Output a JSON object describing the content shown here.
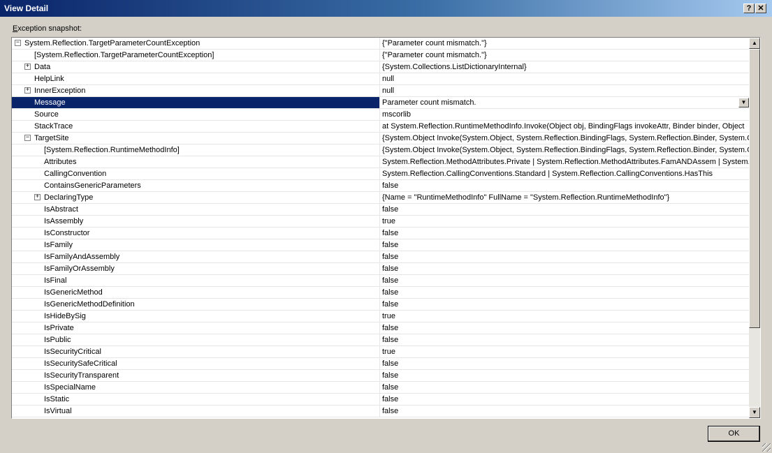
{
  "window": {
    "title": "View Detail",
    "help_label": "?",
    "close_label": "✕"
  },
  "snapshot_label": {
    "accel": "E",
    "rest": "xception snapshot:"
  },
  "rows": [
    {
      "name": "System.Reflection.TargetParameterCountException",
      "value": "{\"Parameter count mismatch.\"}",
      "level": 0,
      "expander": "minus"
    },
    {
      "name": "[System.Reflection.TargetParameterCountException]",
      "value": "{\"Parameter count mismatch.\"}",
      "level": 1,
      "expander": ""
    },
    {
      "name": "Data",
      "value": "{System.Collections.ListDictionaryInternal}",
      "level": 1,
      "expander": "plus"
    },
    {
      "name": "HelpLink",
      "value": "null",
      "level": 1,
      "expander": ""
    },
    {
      "name": "InnerException",
      "value": "null",
      "level": 1,
      "expander": "plus"
    },
    {
      "name": "Message",
      "value": "Parameter count mismatch.",
      "level": 1,
      "expander": "",
      "selected": true,
      "dropdown": true
    },
    {
      "name": "Source",
      "value": "mscorlib",
      "level": 1,
      "expander": ""
    },
    {
      "name": "StackTrace",
      "value": "   at System.Reflection.RuntimeMethodInfo.Invoke(Object obj, BindingFlags invokeAttr, Binder binder, Object",
      "level": 1,
      "expander": ""
    },
    {
      "name": "TargetSite",
      "value": "{System.Object Invoke(System.Object, System.Reflection.BindingFlags, System.Reflection.Binder, System.C",
      "level": 1,
      "expander": "minus"
    },
    {
      "name": "[System.Reflection.RuntimeMethodInfo]",
      "value": "{System.Object Invoke(System.Object, System.Reflection.BindingFlags, System.Reflection.Binder, System.C",
      "level": 2,
      "expander": ""
    },
    {
      "name": "Attributes",
      "value": "System.Reflection.MethodAttributes.Private | System.Reflection.MethodAttributes.FamANDAssem | System.I",
      "level": 2,
      "expander": ""
    },
    {
      "name": "CallingConvention",
      "value": "System.Reflection.CallingConventions.Standard | System.Reflection.CallingConventions.HasThis",
      "level": 2,
      "expander": ""
    },
    {
      "name": "ContainsGenericParameters",
      "value": "false",
      "level": 2,
      "expander": ""
    },
    {
      "name": "DeclaringType",
      "value": "{Name = \"RuntimeMethodInfo\" FullName = \"System.Reflection.RuntimeMethodInfo\"}",
      "level": 2,
      "expander": "plus"
    },
    {
      "name": "IsAbstract",
      "value": "false",
      "level": 2,
      "expander": ""
    },
    {
      "name": "IsAssembly",
      "value": "true",
      "level": 2,
      "expander": ""
    },
    {
      "name": "IsConstructor",
      "value": "false",
      "level": 2,
      "expander": ""
    },
    {
      "name": "IsFamily",
      "value": "false",
      "level": 2,
      "expander": ""
    },
    {
      "name": "IsFamilyAndAssembly",
      "value": "false",
      "level": 2,
      "expander": ""
    },
    {
      "name": "IsFamilyOrAssembly",
      "value": "false",
      "level": 2,
      "expander": ""
    },
    {
      "name": "IsFinal",
      "value": "false",
      "level": 2,
      "expander": ""
    },
    {
      "name": "IsGenericMethod",
      "value": "false",
      "level": 2,
      "expander": ""
    },
    {
      "name": "IsGenericMethodDefinition",
      "value": "false",
      "level": 2,
      "expander": ""
    },
    {
      "name": "IsHideBySig",
      "value": "true",
      "level": 2,
      "expander": ""
    },
    {
      "name": "IsPrivate",
      "value": "false",
      "level": 2,
      "expander": ""
    },
    {
      "name": "IsPublic",
      "value": "false",
      "level": 2,
      "expander": ""
    },
    {
      "name": "IsSecurityCritical",
      "value": "true",
      "level": 2,
      "expander": ""
    },
    {
      "name": "IsSecuritySafeCritical",
      "value": "false",
      "level": 2,
      "expander": ""
    },
    {
      "name": "IsSecurityTransparent",
      "value": "false",
      "level": 2,
      "expander": ""
    },
    {
      "name": "IsSpecialName",
      "value": "false",
      "level": 2,
      "expander": ""
    },
    {
      "name": "IsStatic",
      "value": "false",
      "level": 2,
      "expander": ""
    },
    {
      "name": "IsVirtual",
      "value": "false",
      "level": 2,
      "expander": ""
    }
  ],
  "ok_button": {
    "label": "OK"
  },
  "icons": {
    "expand": "plus-box-icon",
    "collapse": "minus-box-icon",
    "dropdown": "chevron-down-icon"
  }
}
